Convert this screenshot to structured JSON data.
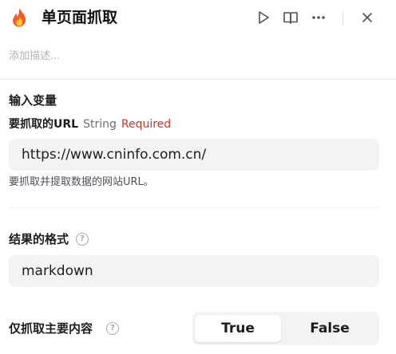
{
  "header": {
    "logo_icon": "fire-icon",
    "title": "单页面抓取",
    "actions": [
      {
        "name": "run",
        "icon": "play-icon"
      },
      {
        "name": "docs",
        "icon": "book-icon"
      },
      {
        "name": "more",
        "icon": "more-horizontal-icon"
      },
      {
        "name": "close",
        "icon": "close-icon"
      }
    ]
  },
  "description_placeholder": "添加描述...",
  "inputs_section": {
    "title": "输入变量",
    "variable": {
      "name": "要抓取的URL",
      "type": "String",
      "required": "Required",
      "value": "https://www.cninfo.com.cn/",
      "hint": "要抓取并提取数据的网站URL。"
    }
  },
  "format_field": {
    "label": "结果的格式",
    "help_icon": "help-circle-icon",
    "value": "markdown"
  },
  "only_main_field": {
    "label": "仅抓取主要内容",
    "help_icon": "help-circle-icon",
    "options": [
      "True",
      "False"
    ],
    "selected": "True"
  },
  "colors": {
    "required": "#c0392b",
    "input_bg": "#f2f3f5",
    "fire_primary": "#f45b2b",
    "fire_inner": "#ffc928"
  }
}
